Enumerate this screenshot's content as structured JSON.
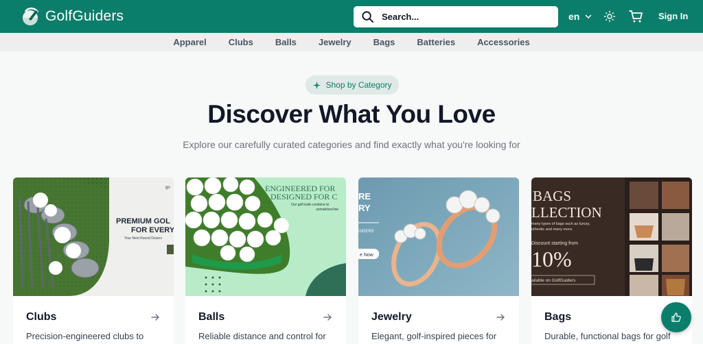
{
  "header": {
    "brand": "GolfGuiders",
    "search_placeholder": "Search...",
    "language": "en",
    "signin_label": "Sign In"
  },
  "nav": {
    "items": [
      "Apparel",
      "Clubs",
      "Balls",
      "Jewelry",
      "Bags",
      "Batteries",
      "Accessories"
    ]
  },
  "hero": {
    "badge": "Shop by Category",
    "title": "Discover What You Love",
    "subtitle": "Explore our carefully curated categories and find exactly what you're looking for"
  },
  "cards": [
    {
      "title": "Clubs",
      "description": "Precision-engineered clubs to",
      "banner_line1": "PREMIUM GOL",
      "banner_line2": "FOR EVERY",
      "banner_line3": "Your Next Round Deserv",
      "banner_corner": "go"
    },
    {
      "title": "Balls",
      "description": "Reliable distance and control for",
      "banner_line1": "ENGINEERED FOR",
      "banner_line2": "DESIGNED FOR C",
      "banner_line3": "Our golf balls combine te",
      "banner_line4": "unmatched fee"
    },
    {
      "title": "Jewelry",
      "description": "Elegant, golf-inspired pieces for",
      "banner_line1": "RE",
      "banner_line2": "RY",
      "banner_line3": "UIDERS",
      "banner_line4": "e Now"
    },
    {
      "title": "Bags",
      "description": "Durable, functional bags for golf",
      "banner_line1": "BAGS",
      "banner_line2": "LLECTION",
      "banner_line3": "many types of bags such as luxury,",
      "banner_line4": "uthentic and many more.",
      "banner_line5": "Discount starting from",
      "banner_line6": "10%",
      "banner_line7": "ailable on GolfGuiders"
    }
  ],
  "colors": {
    "brand": "#0b7d6b",
    "nav_bg": "#eeeeee",
    "page_bg": "#f7f8f8"
  }
}
